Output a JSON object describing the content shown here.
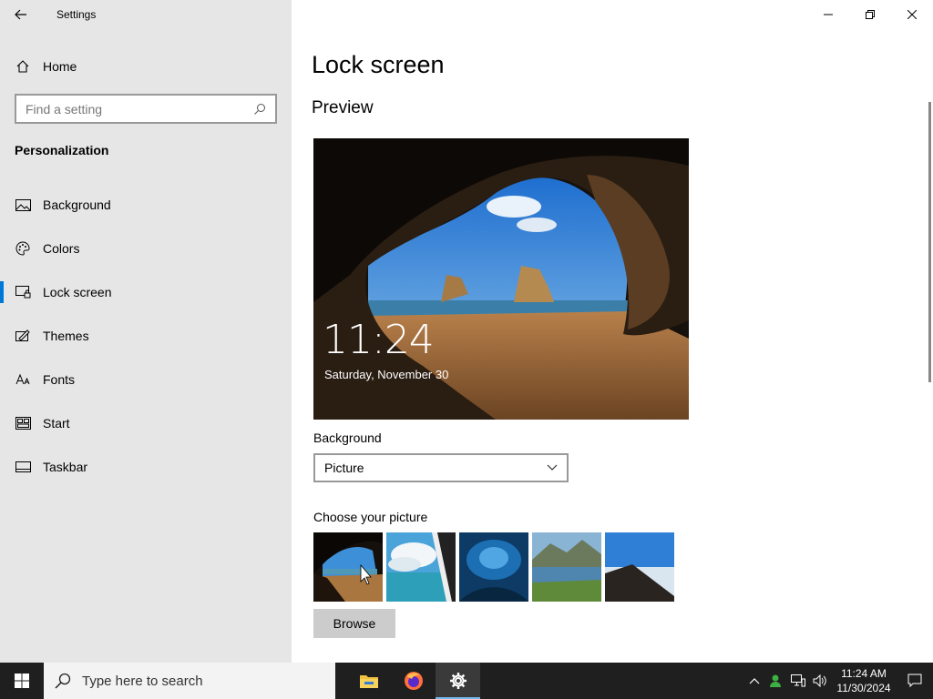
{
  "window": {
    "app_title": "Settings"
  },
  "sidebar": {
    "home_label": "Home",
    "search_placeholder": "Find a setting",
    "section_label": "Personalization",
    "items": [
      {
        "label": "Background",
        "icon": "picture-icon"
      },
      {
        "label": "Colors",
        "icon": "palette-icon"
      },
      {
        "label": "Lock screen",
        "icon": "lock-screen-icon",
        "active": true
      },
      {
        "label": "Themes",
        "icon": "themes-icon"
      },
      {
        "label": "Fonts",
        "icon": "fonts-icon"
      },
      {
        "label": "Start",
        "icon": "start-icon"
      },
      {
        "label": "Taskbar",
        "icon": "taskbar-icon"
      }
    ]
  },
  "main": {
    "title": "Lock screen",
    "preview_heading": "Preview",
    "preview_time": "11:24",
    "preview_date": "Saturday, November 30",
    "background_label": "Background",
    "background_value": "Picture",
    "choose_label": "Choose your picture",
    "browse_label": "Browse"
  },
  "taskbar": {
    "search_placeholder": "Type here to search",
    "time": "11:24 AM",
    "date": "11/30/2024"
  },
  "colors": {
    "accent": "#0078d7",
    "sidebar_bg": "#e6e6e6",
    "taskbar_bg": "#1f1f1f"
  }
}
